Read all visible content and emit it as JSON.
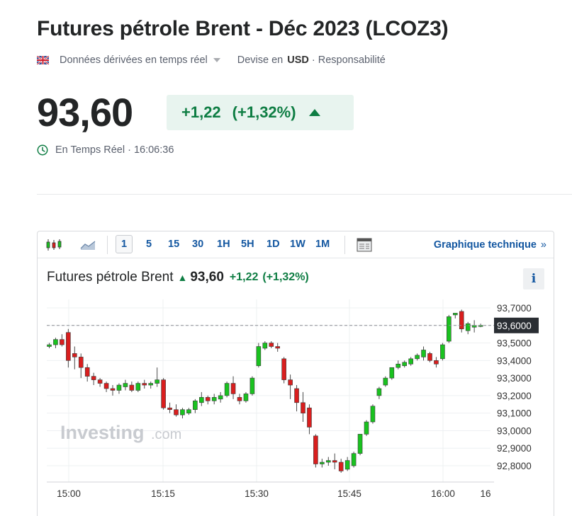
{
  "header": {
    "title": "Futures pétrole Brent - Déc 2023 (LCOZ3)",
    "data_type": "Données dérivées en temps réel",
    "currency_label": "Devise en",
    "currency": "USD",
    "responsibility": "· Responsabilité"
  },
  "quote": {
    "price": "93,60",
    "change": "+1,22",
    "change_pct": "(+1,32%)",
    "status": "En Temps Réel · 16:06:36"
  },
  "toolbar": {
    "timeframes": [
      "1",
      "5",
      "15",
      "30",
      "1H",
      "5H",
      "1D",
      "1W",
      "1M"
    ],
    "active_timeframe": "1",
    "tech_link": "Graphique technique",
    "tech_chevron": "»"
  },
  "chart_header": {
    "name": "Futures pétrole Brent",
    "price": "93,60",
    "change": "+1,22",
    "change_pct": "(+1,32%)",
    "info_label": "i"
  },
  "watermark": {
    "brand": "Investing",
    "suffix": ".com"
  },
  "colors": {
    "up": "#19c21f",
    "down": "#d91e1e",
    "accent": "#1256a0",
    "positive_text": "#0e7d43"
  },
  "chart_data": {
    "type": "candlestick",
    "interval": "1 min",
    "y_ticks": [
      "93,7000",
      "93,6000",
      "93,5000",
      "93,4000",
      "93,3000",
      "93,2000",
      "93,1000",
      "93,0000",
      "92,9000",
      "92,8000"
    ],
    "x_ticks": [
      "15:00",
      "15:15",
      "15:30",
      "15:45",
      "16:00",
      "16"
    ],
    "ylim": [
      92.74,
      93.75
    ],
    "last_price_label": "93,6000",
    "last_price": 93.6,
    "ohlc": [
      [
        93.48,
        93.5,
        93.47,
        93.49
      ],
      [
        93.49,
        93.53,
        93.47,
        93.52
      ],
      [
        93.52,
        93.55,
        93.48,
        93.49
      ],
      [
        93.56,
        93.58,
        93.36,
        93.4
      ],
      [
        93.44,
        93.48,
        93.35,
        93.42
      ],
      [
        93.42,
        93.44,
        93.3,
        93.36
      ],
      [
        93.36,
        93.38,
        93.28,
        93.31
      ],
      [
        93.31,
        93.33,
        93.26,
        93.29
      ],
      [
        93.29,
        93.3,
        93.25,
        93.27
      ],
      [
        93.27,
        93.28,
        93.22,
        93.24
      ],
      [
        93.24,
        93.26,
        93.2,
        93.23
      ],
      [
        93.23,
        93.27,
        93.21,
        93.26
      ],
      [
        93.25,
        93.29,
        93.23,
        93.27
      ],
      [
        93.26,
        93.28,
        93.22,
        93.23
      ],
      [
        93.23,
        93.28,
        93.22,
        93.27
      ],
      [
        93.27,
        93.29,
        93.24,
        93.26
      ],
      [
        93.26,
        93.28,
        93.24,
        93.27
      ],
      [
        93.27,
        93.36,
        93.25,
        93.29
      ],
      [
        93.29,
        93.3,
        93.12,
        93.13
      ],
      [
        93.13,
        93.16,
        93.1,
        93.12
      ],
      [
        93.12,
        93.15,
        93.08,
        93.09
      ],
      [
        93.09,
        93.13,
        93.07,
        93.12
      ],
      [
        93.1,
        93.13,
        93.09,
        93.12
      ],
      [
        93.12,
        93.18,
        93.1,
        93.17
      ],
      [
        93.16,
        93.22,
        93.14,
        93.19
      ],
      [
        93.19,
        93.2,
        93.15,
        93.17
      ],
      [
        93.17,
        93.21,
        93.15,
        93.19
      ],
      [
        93.18,
        93.22,
        93.16,
        93.2
      ],
      [
        93.2,
        93.28,
        93.19,
        93.27
      ],
      [
        93.27,
        93.31,
        93.18,
        93.21
      ],
      [
        93.19,
        93.21,
        93.15,
        93.17
      ],
      [
        93.17,
        93.22,
        93.16,
        93.21
      ],
      [
        93.21,
        93.31,
        93.2,
        93.3
      ],
      [
        93.37,
        93.5,
        93.36,
        93.48
      ],
      [
        93.47,
        93.51,
        93.46,
        93.5
      ],
      [
        93.5,
        93.51,
        93.47,
        93.48
      ],
      [
        93.48,
        93.5,
        93.45,
        93.47
      ],
      [
        93.41,
        93.42,
        93.27,
        93.29
      ],
      [
        93.29,
        93.32,
        93.18,
        93.26
      ],
      [
        93.24,
        93.26,
        93.11,
        93.16
      ],
      [
        93.16,
        93.22,
        93.05,
        93.1
      ],
      [
        93.13,
        93.15,
        92.98,
        93.02
      ],
      [
        92.97,
        92.98,
        92.79,
        92.81
      ],
      [
        92.81,
        92.84,
        92.79,
        92.82
      ],
      [
        92.82,
        92.85,
        92.8,
        92.83
      ],
      [
        92.83,
        92.87,
        92.78,
        92.82
      ],
      [
        92.82,
        92.84,
        92.76,
        92.77
      ],
      [
        92.78,
        92.85,
        92.77,
        92.83
      ],
      [
        92.8,
        92.88,
        92.79,
        92.87
      ],
      [
        92.87,
        92.98,
        92.86,
        92.98
      ],
      [
        92.98,
        93.06,
        92.97,
        93.05
      ],
      [
        93.05,
        93.15,
        93.04,
        93.14
      ],
      [
        93.2,
        93.25,
        93.18,
        93.24
      ],
      [
        93.26,
        93.31,
        93.25,
        93.3
      ],
      [
        93.3,
        93.36,
        93.29,
        93.36
      ],
      [
        93.36,
        93.4,
        93.35,
        93.38
      ],
      [
        93.37,
        93.4,
        93.36,
        93.39
      ],
      [
        93.38,
        93.42,
        93.37,
        93.41
      ],
      [
        93.41,
        93.44,
        93.4,
        93.43
      ],
      [
        93.42,
        93.48,
        93.4,
        93.46
      ],
      [
        93.44,
        93.45,
        93.39,
        93.4
      ],
      [
        93.4,
        93.42,
        93.36,
        93.38
      ],
      [
        93.41,
        93.5,
        93.4,
        93.49
      ],
      [
        93.51,
        93.66,
        93.5,
        93.65
      ],
      [
        93.66,
        93.67,
        93.64,
        93.67
      ],
      [
        93.68,
        93.69,
        93.56,
        93.58
      ],
      [
        93.57,
        93.62,
        93.55,
        93.61
      ],
      [
        93.59,
        93.63,
        93.56,
        93.6
      ],
      [
        93.6,
        93.61,
        93.59,
        93.6
      ]
    ]
  }
}
